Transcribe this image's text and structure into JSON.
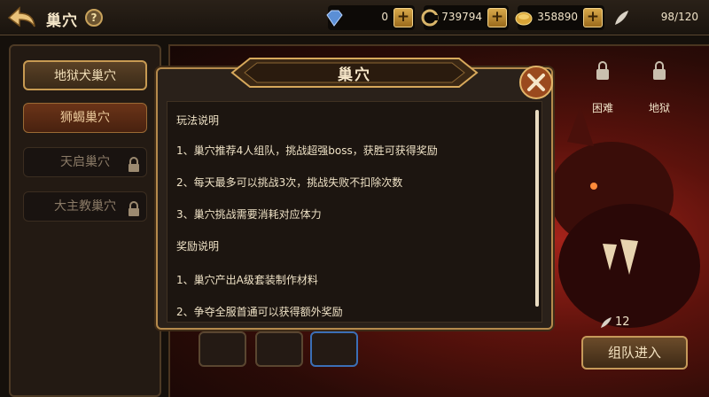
{
  "header": {
    "title": "巢穴",
    "help_icon": "question-icon"
  },
  "resources": [
    {
      "name": "gem",
      "icon": "gem-icon",
      "value": "0"
    },
    {
      "name": "coin",
      "icon": "coin-c-icon",
      "value": "739794"
    },
    {
      "name": "gold",
      "icon": "gold-icon",
      "value": "358890"
    },
    {
      "name": "stamina",
      "icon": "feather-icon",
      "value": "98/120"
    }
  ],
  "sidebar": {
    "items": [
      {
        "label": "地狱犬巢穴",
        "state": "active"
      },
      {
        "label": "狮蝎巢穴",
        "state": "selected"
      },
      {
        "label": "天启巢穴",
        "state": "locked"
      },
      {
        "label": "大主教巢穴",
        "state": "locked"
      }
    ]
  },
  "difficulty": [
    {
      "label": "困难"
    },
    {
      "label": "地狱"
    }
  ],
  "team": {
    "count": "12",
    "button_label": "组队进入"
  },
  "modal": {
    "title": "巢穴",
    "lines": [
      "玩法说明",
      "1、巢穴推荐4人组队，挑战超强boss，获胜可获得奖励",
      "2、每天最多可以挑战3次，挑战失败不扣除次数",
      "3、巢穴挑战需要消耗对应体力",
      "奖励说明",
      "1、巢穴产出A级套装制作材料",
      "2、争夺全服首通可以获得额外奖励"
    ]
  },
  "colors": {
    "accent_gold": "#c79a52",
    "panel_bg": "#2a211a",
    "scene_red": "#a4231a"
  }
}
